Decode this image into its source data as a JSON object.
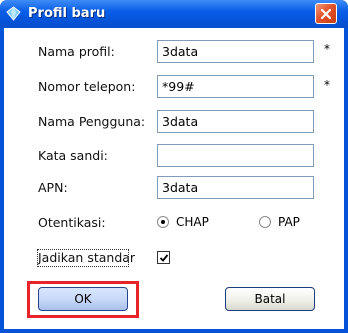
{
  "window": {
    "title": "Profil baru"
  },
  "form": {
    "profile_name": {
      "label": "Nama profil:",
      "value": "3data",
      "required": "*"
    },
    "phone": {
      "label": "Nomor telepon:",
      "value": "*99#",
      "required": "*"
    },
    "username": {
      "label": "Nama Pengguna:",
      "value": "3data"
    },
    "password": {
      "label": "Kata sandi:",
      "value": ""
    },
    "apn": {
      "label": "APN:",
      "value": "3data"
    },
    "auth": {
      "label": "Otentikasi:",
      "options": [
        "CHAP",
        "PAP"
      ],
      "selected": "CHAP"
    },
    "default": {
      "label": "Jadikan standar",
      "checked": true
    }
  },
  "buttons": {
    "ok": "OK",
    "cancel": "Batal"
  },
  "colors": {
    "titlebar": "#0553d8",
    "highlight": "#e8242b"
  }
}
